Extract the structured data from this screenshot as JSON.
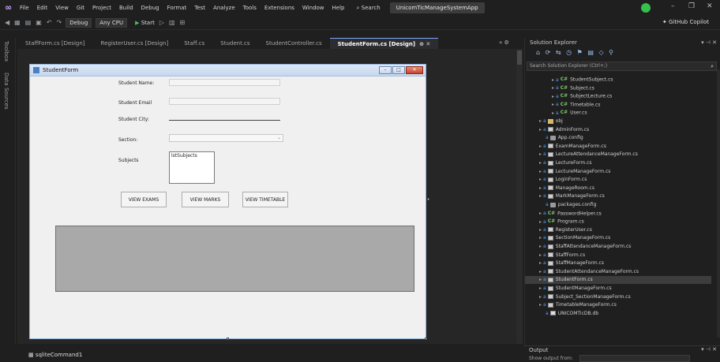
{
  "titlebar": {
    "menu": [
      "File",
      "Edit",
      "View",
      "Git",
      "Project",
      "Build",
      "Debug",
      "Format",
      "Test",
      "Analyze",
      "Tools",
      "Extensions",
      "Window",
      "Help"
    ],
    "search_label": "Search",
    "solution_name": "UnicomTicManageSystemApp"
  },
  "toolbar": {
    "config": "Debug",
    "platform": "Any CPU",
    "start_label": "Start",
    "copilot_label": "GitHub Copilot"
  },
  "left_strip": {
    "toolbox": "Toolbox",
    "data_sources": "Data Sources"
  },
  "tabs": [
    {
      "label": "StaffForm.cs [Design]",
      "active": false
    },
    {
      "label": "RegisterUser.cs [Design]",
      "active": false
    },
    {
      "label": "Staff.cs",
      "active": false
    },
    {
      "label": "Student.cs",
      "active": false
    },
    {
      "label": "StudentController.cs",
      "active": false
    },
    {
      "label": "StudentForm.cs [Design]",
      "active": true
    }
  ],
  "form": {
    "title": "StudentForm",
    "labels": {
      "name": "Student Name:",
      "email": "Student Email",
      "city": "Student City:",
      "section": "Section:",
      "subjects": "Subjects"
    },
    "listbox_text": "lstSubjects",
    "buttons": {
      "view_exams": "VIEW EXAMS",
      "view_marks": "VIEW MARKS",
      "view_timetable": "VIEW TIMETABLE"
    }
  },
  "bottom": {
    "component": "sqliteCommand1"
  },
  "solution_explorer": {
    "title": "Solution Explorer",
    "search_placeholder": "Search Solution Explorer (Ctrl+;)",
    "items": [
      {
        "label": "StudentSubject.cs",
        "type": "cs",
        "indent": 3
      },
      {
        "label": "Subject.cs",
        "type": "cs",
        "indent": 3
      },
      {
        "label": "SubjectLecture.cs",
        "type": "cs",
        "indent": 3
      },
      {
        "label": "Timetable.cs",
        "type": "cs",
        "indent": 3
      },
      {
        "label": "User.cs",
        "type": "cs",
        "indent": 3
      },
      {
        "label": "obj",
        "type": "folder",
        "indent": 1
      },
      {
        "label": "AdminForm.cs",
        "type": "form",
        "indent": 1
      },
      {
        "label": "App.config",
        "type": "cfg",
        "indent": 2
      },
      {
        "label": "ExamManageForm.cs",
        "type": "form",
        "indent": 1
      },
      {
        "label": "LectureAttendanceManageForm.cs",
        "type": "form",
        "indent": 1
      },
      {
        "label": "LectureForm.cs",
        "type": "form",
        "indent": 1
      },
      {
        "label": "LectureManageForm.cs",
        "type": "form",
        "indent": 1
      },
      {
        "label": "LoginForm.cs",
        "type": "form",
        "indent": 1
      },
      {
        "label": "ManageRoom.cs",
        "type": "form",
        "indent": 1
      },
      {
        "label": "MarkManageForm.cs",
        "type": "form",
        "indent": 1
      },
      {
        "label": "packages.config",
        "type": "cfg",
        "indent": 2
      },
      {
        "label": "PasswordHelper.cs",
        "type": "cs",
        "indent": 1
      },
      {
        "label": "Program.cs",
        "type": "cs",
        "indent": 1
      },
      {
        "label": "RegisterUser.cs",
        "type": "form",
        "indent": 1
      },
      {
        "label": "SectionManageForm.cs",
        "type": "form",
        "indent": 1
      },
      {
        "label": "StaffAttendanceManageForm.cs",
        "type": "form",
        "indent": 1
      },
      {
        "label": "StaffForm.cs",
        "type": "form",
        "indent": 1
      },
      {
        "label": "StaffManageForm.cs",
        "type": "form",
        "indent": 1
      },
      {
        "label": "StudentAttendanceManageForm.cs",
        "type": "form",
        "indent": 1
      },
      {
        "label": "StudentForm.cs",
        "type": "form",
        "indent": 1,
        "selected": true
      },
      {
        "label": "StudentManageForm.cs",
        "type": "form",
        "indent": 1
      },
      {
        "label": "Subject_SectionManageForm.cs",
        "type": "form",
        "indent": 1
      },
      {
        "label": "TimetableManageForm.cs",
        "type": "form",
        "indent": 1
      },
      {
        "label": "UNICOMTicDB.db",
        "type": "db",
        "indent": 2
      }
    ]
  },
  "output": {
    "title": "Output",
    "show_from": "Show output from:"
  }
}
